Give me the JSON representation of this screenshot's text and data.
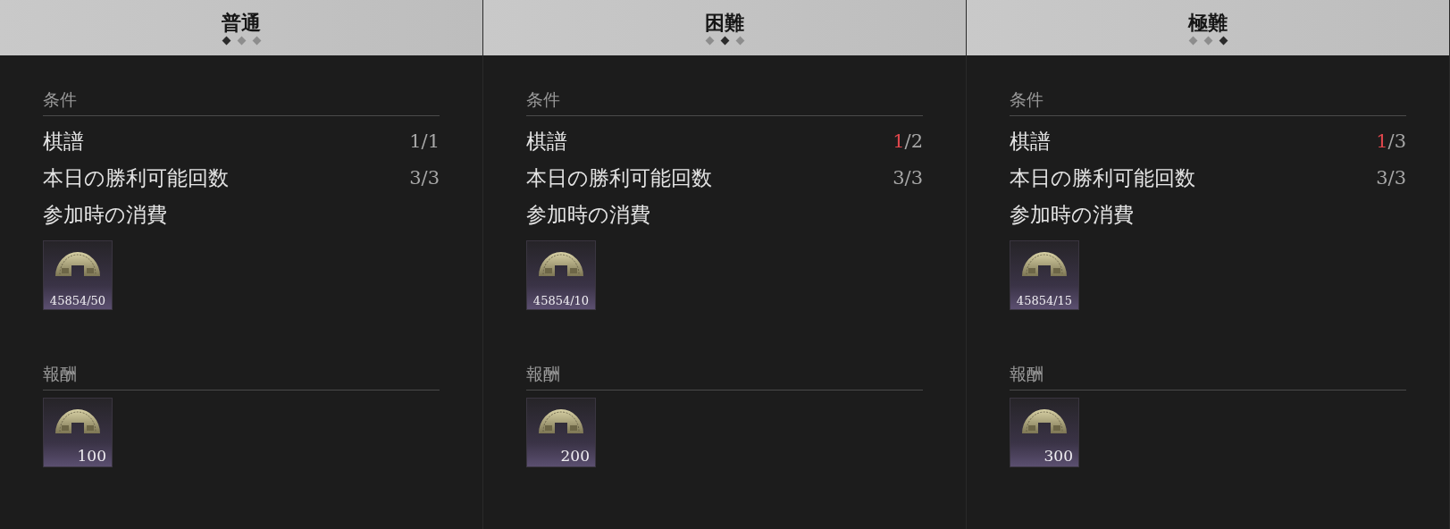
{
  "panels": [
    {
      "title": "普通",
      "dots": [
        {
          "selected": true
        },
        {
          "selected": false
        },
        {
          "selected": false
        }
      ],
      "conditions_label": "条件",
      "conditions": [
        {
          "label": "棋譜",
          "progress": "1/1",
          "met": true
        },
        {
          "label": "本日の勝利可能回数",
          "progress": "3/3",
          "met": true
        },
        {
          "label": "参加時の消費"
        }
      ],
      "cost_item": {
        "count": "45854/50"
      },
      "rewards_label": "報酬",
      "reward_item": {
        "count": "100"
      }
    },
    {
      "title": "困難",
      "dots": [
        {
          "selected": false
        },
        {
          "selected": true
        },
        {
          "selected": false
        }
      ],
      "conditions_label": "条件",
      "conditions": [
        {
          "label": "棋譜",
          "progress": "1/2",
          "met": false
        },
        {
          "label": "本日の勝利可能回数",
          "progress": "3/3",
          "met": true
        },
        {
          "label": "参加時の消費"
        }
      ],
      "cost_item": {
        "count": "45854/10"
      },
      "rewards_label": "報酬",
      "reward_item": {
        "count": "200"
      }
    },
    {
      "title": "極難",
      "dots": [
        {
          "selected": false
        },
        {
          "selected": false
        },
        {
          "selected": true
        }
      ],
      "conditions_label": "条件",
      "conditions": [
        {
          "label": "棋譜",
          "progress": "1/3",
          "met": false
        },
        {
          "label": "本日の勝利可能回数",
          "progress": "3/3",
          "met": true
        },
        {
          "label": "参加時の消費"
        }
      ],
      "cost_item": {
        "count": "45854/15"
      },
      "rewards_label": "報酬",
      "reward_item": {
        "count": "300"
      }
    }
  ]
}
